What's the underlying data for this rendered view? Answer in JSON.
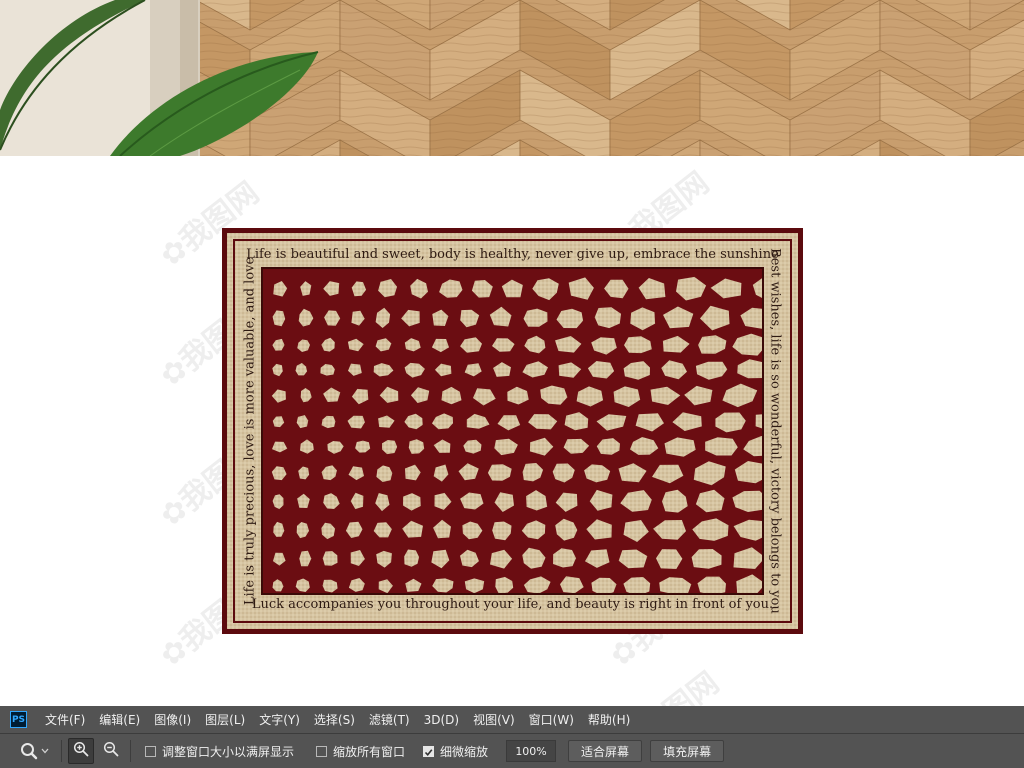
{
  "rug": {
    "top_text": "Life is beautiful and sweet, body is healthy, never give up, embrace the sunshine",
    "left_text": "Life is truly precious, love is more valuable, and love",
    "right_text": "Best wishes, life is so wonderful, victory belongs to you",
    "bottom_text": "Luck accompanies you throughout your life, and beauty is right in front of you.",
    "colors": {
      "border": "#5c0a0e",
      "background": "#d6c4a2",
      "pattern": "#6b0d12"
    }
  },
  "menubar": {
    "app_icon": "PS",
    "items": [
      "文件(F)",
      "编辑(E)",
      "图像(I)",
      "图层(L)",
      "文字(Y)",
      "选择(S)",
      "滤镜(T)",
      "3D(D)",
      "视图(V)",
      "窗口(W)",
      "帮助(H)"
    ]
  },
  "options": {
    "tool_icon": "zoom-tool-icon",
    "zoom_in_icon": "zoom-in-icon",
    "zoom_out_icon": "zoom-out-icon",
    "resize_windows_label": "调整窗口大小以满屏显示",
    "resize_windows_checked": false,
    "zoom_all_windows_label": "缩放所有窗口",
    "zoom_all_windows_checked": false,
    "scrubby_zoom_label": "细微缩放",
    "scrubby_zoom_checked": true,
    "zoom_value": "100%",
    "fit_screen_label": "适合屏幕",
    "fill_screen_label": "填充屏幕"
  },
  "colors": {
    "ui_panel": "#535353",
    "ui_text": "#f0f0f0"
  }
}
